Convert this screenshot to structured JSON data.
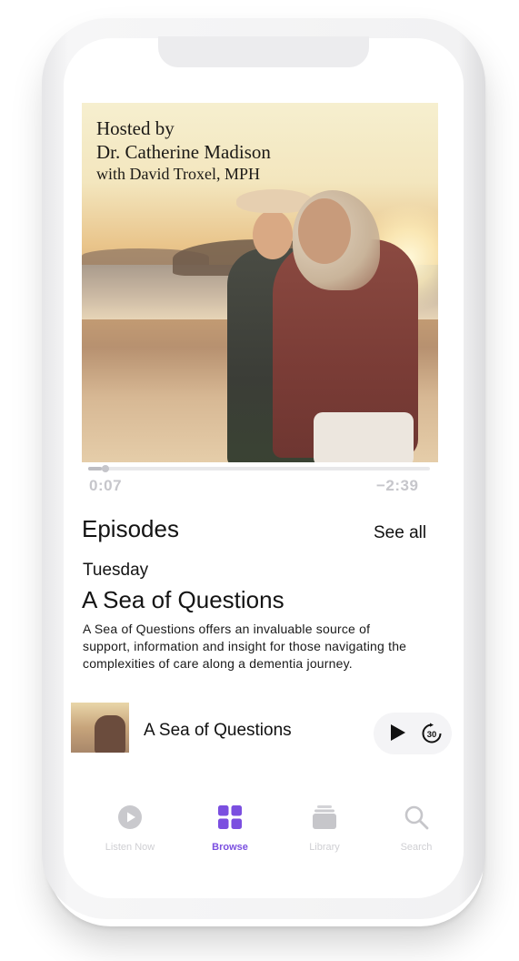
{
  "artwork": {
    "line1": "Hosted by",
    "line2": "Dr. Catherine Madison",
    "line3": "with David Troxel, MPH"
  },
  "player": {
    "elapsed": "0:07",
    "remaining": "−2:39",
    "progress_fraction": 0.04
  },
  "episodes": {
    "heading": "Episodes",
    "see_all_label": "See all",
    "featured": {
      "day": "Tuesday",
      "title": "A Sea of Questions",
      "description": "A Sea of Questions offers an invaluable source of support, information and insight for those navigating the complexities of care along a dementia journey."
    }
  },
  "mini_player": {
    "title": "A Sea of Questions",
    "play_icon": "play-icon",
    "skip_icon": "skip-forward-30-icon",
    "skip_label": "30"
  },
  "tab_bar": {
    "items": [
      {
        "label": "Listen Now",
        "icon": "play-circle-icon",
        "active": false
      },
      {
        "label": "Browse",
        "icon": "grid-icon",
        "active": true
      },
      {
        "label": "Library",
        "icon": "library-icon",
        "active": false
      },
      {
        "label": "Search",
        "icon": "search-icon",
        "active": false
      }
    ]
  },
  "colors": {
    "accent": "#7b4fe0",
    "inactive": "#cfcfd3"
  }
}
